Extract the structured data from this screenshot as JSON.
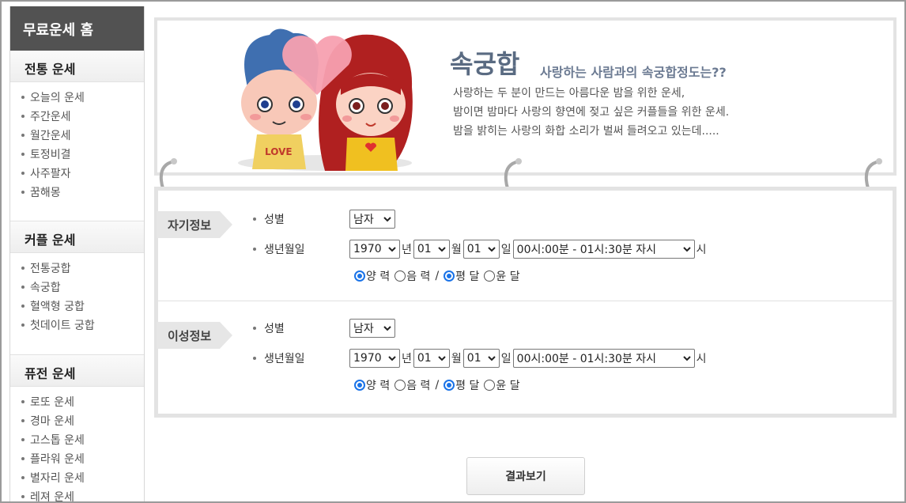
{
  "sidebar": {
    "home": "무료운세 홈",
    "categories": [
      {
        "title": "전통 운세",
        "items": [
          "오늘의 운세",
          "주간운세",
          "월간운세",
          "토정비결",
          "사주팔자",
          "꿈해몽"
        ]
      },
      {
        "title": "커플 운세",
        "items": [
          "전통궁합",
          "속궁합",
          "혈액형 궁합",
          "첫데이트 궁합"
        ]
      },
      {
        "title": "퓨전 운세",
        "items": [
          "로또 운세",
          "경마 운세",
          "고스톱 운세",
          "플라워 운세",
          "별자리 운세",
          "레져 운세"
        ]
      }
    ]
  },
  "banner": {
    "title": "속궁합",
    "subtitle": "사랑하는 사람과의 속궁합정도는??",
    "lines": [
      "사랑하는 두 분이 만드는 아름다운 밤을 위한 운세,",
      "밤이면 밤마다 사랑의 향연에 젖고 싶은 커플들을 위한 운세.",
      "밤을 밝히는 사랑의 화합 소리가 벌써 들려오고 있는데....."
    ],
    "mascot_text": "LOVE"
  },
  "form": {
    "self": {
      "tag": "자기정보",
      "gender_label": "성별",
      "gender": "남자",
      "birth_label": "생년월일",
      "year": "1970",
      "month": "01",
      "day": "01",
      "hour": "00시:00분 - 01시:30분 자시"
    },
    "partner": {
      "tag": "이성정보",
      "gender_label": "성별",
      "gender": "남자",
      "birth_label": "생년월일",
      "year": "1970",
      "month": "01",
      "day": "01",
      "hour": "00시:00분 - 01시:30분 자시"
    },
    "units": {
      "year": "년",
      "month": "월",
      "day": "일",
      "hour": "시"
    },
    "calendar": {
      "solar": "양 력",
      "lunar": "음 력",
      "slash": "/",
      "normal": "평 달",
      "leap": "윤 달"
    }
  },
  "result_button": "결과보기",
  "colors": {
    "sidebar_home_bg": "#525252",
    "title_color": "#5a6b82",
    "radio_accent": "#1a73e8"
  }
}
